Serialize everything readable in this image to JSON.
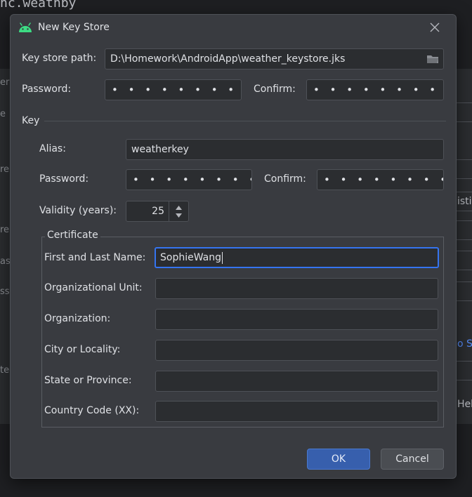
{
  "background": {
    "code_text": "nc.weathby",
    "left_fragments": [
      "er",
      "e",
      "re",
      "re",
      "as",
      "ssw",
      "ted"
    ],
    "right_fragments": [
      "istin",
      "o Si",
      "Hel"
    ]
  },
  "dialog": {
    "title": "New Key Store",
    "keystore_path": {
      "label": "Key store path:",
      "value": "D:\\Homework\\AndroidApp\\weather_keystore.jks"
    },
    "password": {
      "label": "Password:",
      "value": "• • • • • • • • • •"
    },
    "confirm": {
      "label": "Confirm:",
      "value": "• • • • • • • • • •"
    },
    "key_section": {
      "title": "Key",
      "alias": {
        "label": "Alias:",
        "value": "weatherkey"
      },
      "password": {
        "label": "Password:",
        "value": "• • • • • • • • • •"
      },
      "confirm": {
        "label": "Confirm:",
        "value": "• • • • • • • • • •"
      },
      "validity": {
        "label": "Validity (years):",
        "value": "25"
      },
      "certificate": {
        "title": "Certificate",
        "fields": [
          {
            "label": "First and Last Name:",
            "value": "SophieWang"
          },
          {
            "label": "Organizational Unit:",
            "value": ""
          },
          {
            "label": "Organization:",
            "value": ""
          },
          {
            "label": "City or Locality:",
            "value": ""
          },
          {
            "label": "State or Province:",
            "value": ""
          },
          {
            "label": "Country Code (XX):",
            "value": ""
          }
        ]
      }
    },
    "buttons": {
      "ok": "OK",
      "cancel": "Cancel"
    }
  },
  "colors": {
    "accent": "#3574f0",
    "android_green": "#3ddc84",
    "dialog_bg": "#393b40",
    "field_bg": "#2b2d30"
  }
}
